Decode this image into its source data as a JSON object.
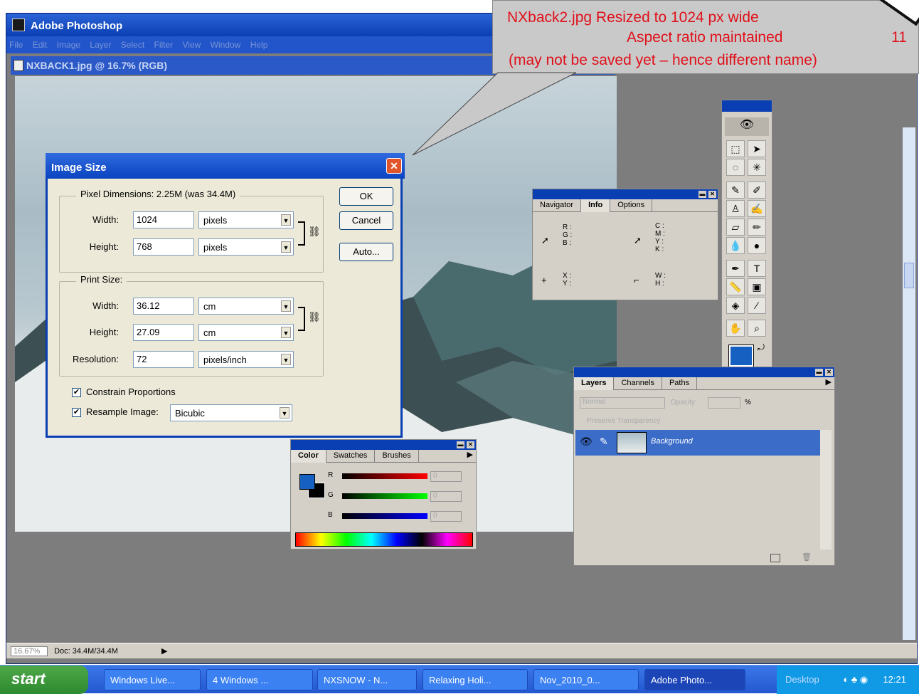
{
  "app": {
    "title": "Adobe Photoshop",
    "menu": [
      "File",
      "Edit",
      "Image",
      "Layer",
      "Select",
      "Filter",
      "View",
      "Window",
      "Help"
    ],
    "document_title": "NXBACK1.jpg @ 16.7% (RGB)",
    "status": {
      "zoom": "16.67%",
      "doc": "Doc: 34.4M/34.4M"
    }
  },
  "callout": {
    "line1": "NXback2.jpg  Resized to 1024 px wide",
    "line2": "Aspect ratio maintained",
    "line2_extra": "11",
    "line3": "(may not be saved yet – hence different name)"
  },
  "image_size": {
    "title": "Image Size",
    "close": "✕",
    "pixel_dimensions": "Pixel Dimensions:  2.25M (was 34.4M)",
    "width_label": "Width:",
    "height_label": "Height:",
    "width_value": "1024",
    "height_value": "768",
    "px_unit": "pixels",
    "print_size": "Print Size:",
    "print_width_label": "Width:",
    "print_height_label": "Height:",
    "print_width": "36.12",
    "print_height": "27.09",
    "cm_unit": "cm",
    "resolution_label": "Resolution:",
    "resolution": "72",
    "res_unit": "pixels/inch",
    "constrain": "Constrain Proportions",
    "resample": "Resample Image:",
    "resample_method": "Bicubic",
    "ok": "OK",
    "cancel": "Cancel",
    "auto": "Auto..."
  },
  "info_palette": {
    "tabs": [
      "Navigator",
      "Info",
      "Options"
    ],
    "rgb": "R :\nG :\nB :",
    "cmyk": "C :\nM :\nY :\nK :",
    "xy": "X :\nY :",
    "wh": "W :\nH :"
  },
  "color_palette": {
    "tabs": [
      "Color",
      "Swatches",
      "Brushes"
    ],
    "r": "R",
    "g": "G",
    "b": "B",
    "r_val": "0",
    "g_val": "0",
    "b_val": "0",
    "fg_color": "#1560c0",
    "bg_color": "#000000"
  },
  "layers_palette": {
    "tabs": [
      "Layers",
      "Channels",
      "Paths"
    ],
    "blend": "Normal",
    "opacity_label": "Opacity:",
    "opacity_unit": "%",
    "preserve": "Preserve Transparency",
    "layer_name": "Background"
  },
  "taskbar": {
    "start": "start",
    "tasks": [
      "Windows Live...",
      "4 Windows ...",
      "NXSNOW - N...",
      "Relaxing Holi...",
      "Nov_2010_0...",
      "Adobe Photo..."
    ],
    "desktop": "Desktop",
    "time": "12:21"
  }
}
